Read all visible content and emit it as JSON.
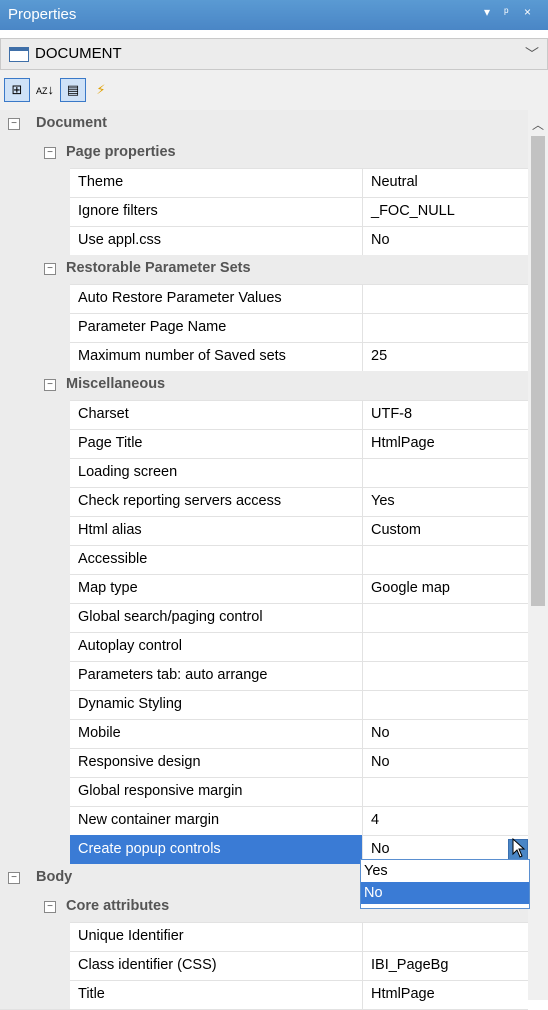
{
  "window": {
    "title": "Properties",
    "controls": [
      "▾",
      "ᵖ",
      "×"
    ]
  },
  "object_selector": {
    "value": "DOCUMENT"
  },
  "toolbar": {
    "buttons": [
      {
        "icon": "categorized-icon",
        "glyph": "⊞",
        "active": true
      },
      {
        "icon": "alphabetical-icon",
        "glyph": "↓",
        "sub": "AZ",
        "active": false
      },
      {
        "icon": "properties-page-icon",
        "glyph": "▤",
        "active": true
      },
      {
        "icon": "events-icon",
        "glyph": "⚡",
        "active": false
      }
    ]
  },
  "grid": {
    "rows": [
      {
        "type": "cat",
        "level": 0,
        "label": "Document"
      },
      {
        "type": "cat",
        "level": 1,
        "label": "Page properties"
      },
      {
        "type": "prop",
        "name": "Theme",
        "value": "Neutral"
      },
      {
        "type": "prop",
        "name": "Ignore filters",
        "value": "_FOC_NULL"
      },
      {
        "type": "prop",
        "name": "Use appl.css",
        "value": "No"
      },
      {
        "type": "cat",
        "level": 1,
        "label": "Restorable Parameter Sets"
      },
      {
        "type": "prop",
        "name": "Auto Restore Parameter Values",
        "value": ""
      },
      {
        "type": "prop",
        "name": "Parameter Page Name",
        "value": ""
      },
      {
        "type": "prop",
        "name": "Maximum number of Saved sets",
        "value": "25"
      },
      {
        "type": "cat",
        "level": 1,
        "label": "Miscellaneous"
      },
      {
        "type": "prop",
        "name": "Charset",
        "value": "UTF-8"
      },
      {
        "type": "prop",
        "name": "Page Title",
        "value": "HtmlPage"
      },
      {
        "type": "prop",
        "name": "Loading screen",
        "value": ""
      },
      {
        "type": "prop",
        "name": "Check reporting servers access",
        "value": "Yes"
      },
      {
        "type": "prop",
        "name": "Html alias",
        "value": "Custom"
      },
      {
        "type": "prop",
        "name": "Accessible",
        "value": ""
      },
      {
        "type": "prop",
        "name": "Map type",
        "value": "Google map"
      },
      {
        "type": "prop",
        "name": "Global search/paging control",
        "value": ""
      },
      {
        "type": "prop",
        "name": "Autoplay control",
        "value": ""
      },
      {
        "type": "prop",
        "name": "Parameters tab: auto arrange",
        "value": ""
      },
      {
        "type": "prop",
        "name": "Dynamic Styling",
        "value": ""
      },
      {
        "type": "prop",
        "name": "Mobile",
        "value": "No"
      },
      {
        "type": "prop",
        "name": "Responsive design",
        "value": "No"
      },
      {
        "type": "prop",
        "name": "Global responsive margin",
        "value": ""
      },
      {
        "type": "prop",
        "name": "New container margin",
        "value": "4"
      },
      {
        "type": "prop",
        "name": "Create popup controls",
        "value": "No",
        "selected": true
      },
      {
        "type": "cat",
        "level": 0,
        "label": "Body"
      },
      {
        "type": "cat",
        "level": 1,
        "label": "Core attributes"
      },
      {
        "type": "prop",
        "name": "Unique Identifier",
        "value": ""
      },
      {
        "type": "prop",
        "name": "Class identifier (CSS)",
        "value": "IBI_PageBg"
      },
      {
        "type": "prop",
        "name": "Title",
        "value": "HtmlPage"
      }
    ]
  },
  "dropdown": {
    "options": [
      "Yes",
      "No"
    ],
    "highlighted": "No"
  },
  "colors": {
    "title_bar": "#4a86c6",
    "selection": "#3a7bd5",
    "category_bg": "#ececec"
  }
}
